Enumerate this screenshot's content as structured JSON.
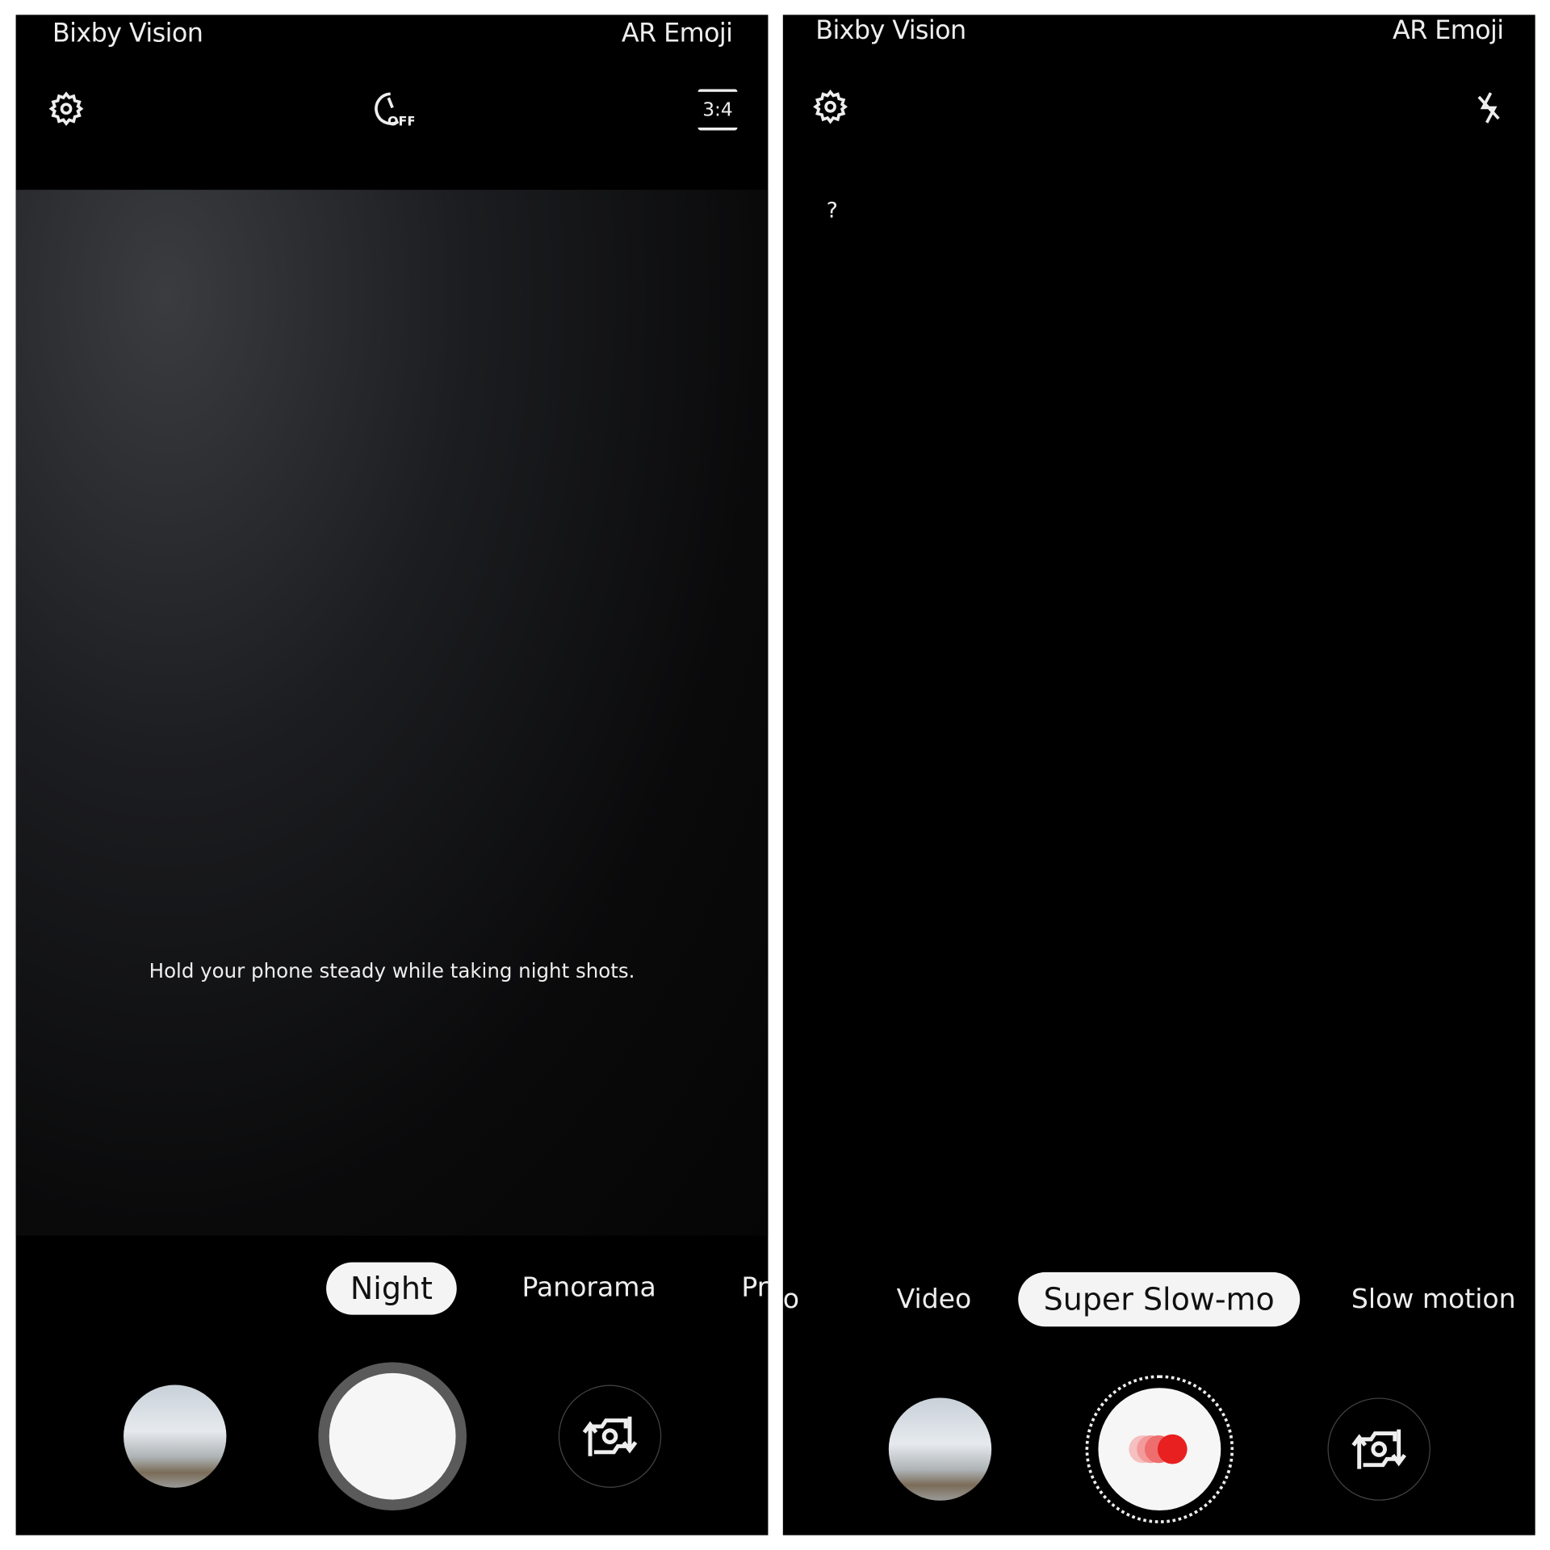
{
  "left_screen": {
    "top_links": {
      "bixby": "Bixby Vision",
      "ar_emoji": "AR Emoji"
    },
    "toolbar": {
      "settings_icon": "gear-icon",
      "timer_icon": "timer-off-icon",
      "timer_label": "OFF",
      "ratio_label": "3:4"
    },
    "hint": "Hold your phone steady while taking night shots.",
    "modes": {
      "selected": "Night",
      "next": "Panorama",
      "clipped": "Pr"
    },
    "controls": {
      "gallery": "gallery-thumbnail",
      "shutter": "shutter-button",
      "switch": "switch-camera-icon"
    }
  },
  "right_screen": {
    "top_links": {
      "bixby": "Bixby Vision",
      "ar_emoji": "AR Emoji"
    },
    "toolbar": {
      "settings_icon": "gear-icon",
      "flash_icon": "flash-off-icon"
    },
    "help": "?",
    "modes": {
      "clipped": "o",
      "prev": "Video",
      "selected": "Super Slow-mo",
      "next": "Slow motion"
    },
    "controls": {
      "gallery": "gallery-thumbnail",
      "record": "super-slow-mo-record-button",
      "switch": "switch-camera-icon"
    },
    "record_color": "#e82020"
  }
}
